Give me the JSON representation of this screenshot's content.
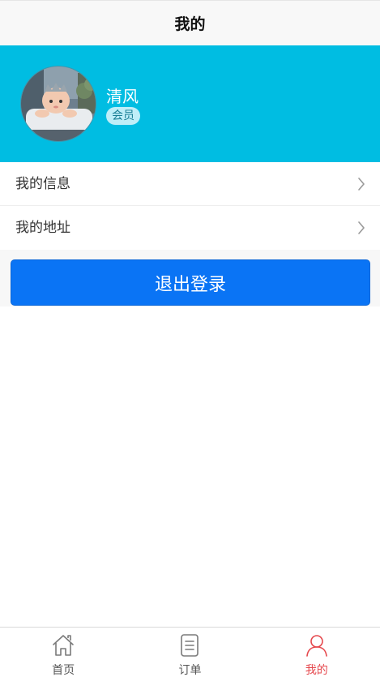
{
  "header": {
    "title": "我的"
  },
  "profile": {
    "username": "清风",
    "badge": "会员"
  },
  "menu": {
    "items": [
      {
        "label": "我的信息",
        "icon": "chevron-right-icon"
      },
      {
        "label": "我的地址",
        "icon": "chevron-right-icon"
      }
    ]
  },
  "logout": {
    "label": "退出登录"
  },
  "tabbar": {
    "items": [
      {
        "label": "首页",
        "icon": "home-icon",
        "active": false
      },
      {
        "label": "订单",
        "icon": "document-icon",
        "active": false
      },
      {
        "label": "我的",
        "icon": "user-icon",
        "active": true
      }
    ]
  },
  "colors": {
    "profile_bg": "#00bde2",
    "primary_button": "#0a74f5",
    "active_tab": "#e5484d"
  }
}
